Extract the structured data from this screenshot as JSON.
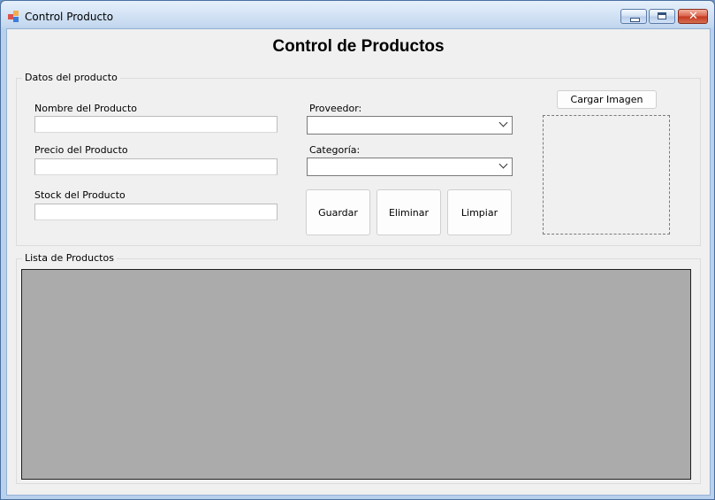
{
  "window": {
    "title": "Control Producto",
    "icon": "app-window-icon"
  },
  "heading": "Control de Productos",
  "datos_group": {
    "legend": "Datos del producto",
    "nombre_label": "Nombre del Producto",
    "nombre_value": "",
    "precio_label": "Precio del Producto",
    "precio_value": "",
    "stock_label": "Stock del Producto",
    "stock_value": "",
    "proveedor_label": "Proveedor:",
    "proveedor_value": "",
    "categoria_label": "Categoría:",
    "categoria_value": "",
    "guardar_label": "Guardar",
    "eliminar_label": "Eliminar",
    "limpiar_label": "Limpiar",
    "cargar_imagen_label": "Cargar Imagen"
  },
  "lista_group": {
    "legend": "Lista de Productos"
  },
  "colors": {
    "client_background": "#f0f0f0",
    "grid_background": "#ababab",
    "title_bar": "#c4d8ef"
  }
}
